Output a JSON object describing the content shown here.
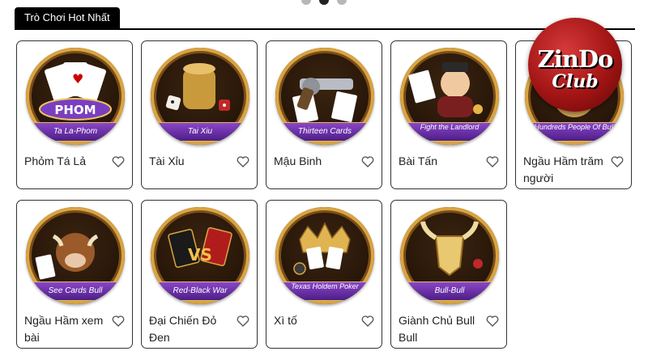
{
  "carousel": {
    "count": 3,
    "active": 2
  },
  "section": {
    "title": "Trò Chơi Hot Nhất"
  },
  "logo": {
    "text_top": "ZinDo",
    "text_bottom": "Club"
  },
  "games": [
    {
      "title": "Phỏm Tá Lả",
      "banner": "Ta La-Phom",
      "icon": "playing-cards-icon"
    },
    {
      "title": "Tài Xỉu",
      "banner": "Tai Xiu",
      "icon": "dice-cup-icon"
    },
    {
      "title": "Mậu Binh",
      "banner": "Thirteen Cards",
      "icon": "revolver-icon"
    },
    {
      "title": "Bài Tấn",
      "banner": "Fight the Landlord",
      "icon": "landlord-character-icon"
    },
    {
      "title": "Ngầu Hầm trăm người",
      "banner": "Hundreds People Of Bull",
      "icon": "bull-icon"
    },
    {
      "title": "Ngầu Hầm xem bài",
      "banner": "See Cards Bull",
      "icon": "bull-character-icon"
    },
    {
      "title": "Đại Chiến Đỏ Đen",
      "banner": "Red-Black War",
      "icon": "vs-cards-icon"
    },
    {
      "title": "Xì tố",
      "banner": "Texas Holdem Poker",
      "icon": "crown-cards-icon"
    },
    {
      "title": "Giành Chủ Bull Bull",
      "banner": "Bull-Bull",
      "icon": "bull-head-icon"
    }
  ],
  "colors": {
    "ribbon": "#6a2fb0",
    "gold": "#d9a441",
    "logo_red": "#a31414"
  }
}
